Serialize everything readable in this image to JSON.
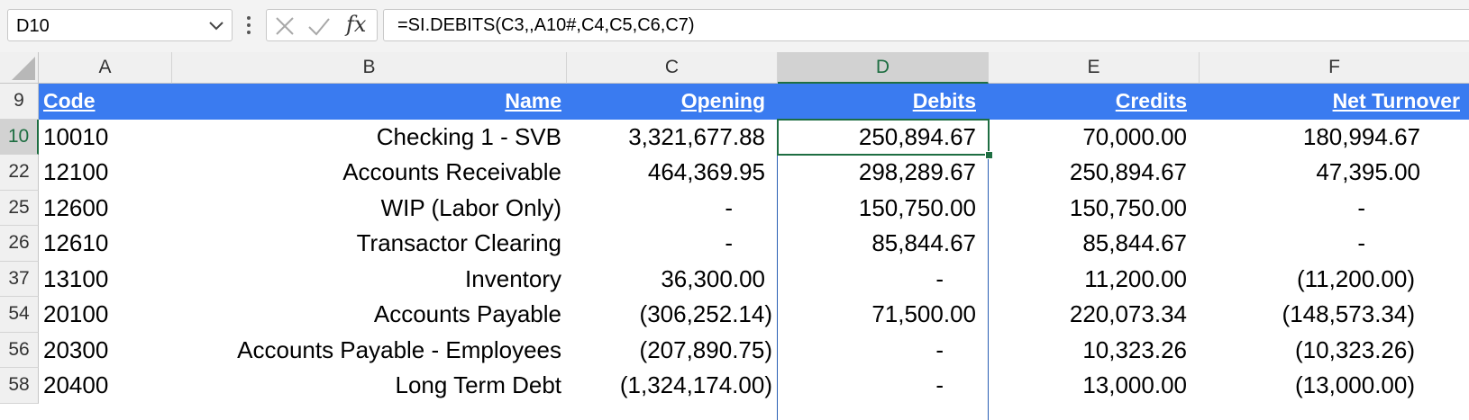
{
  "formula_bar": {
    "name_box": "D10",
    "formula": "=SI.DEBITS(C3,,A10#,C4,C5,C6,C7)",
    "fx_label": "fx"
  },
  "columns": [
    "A",
    "B",
    "C",
    "D",
    "E",
    "F"
  ],
  "selected_column": "D",
  "header_row": {
    "row_number": "9",
    "cells": [
      "Code",
      "Name",
      "Opening",
      "Debits",
      "Credits",
      "Net Turnover"
    ]
  },
  "rows": [
    {
      "row_number": "10",
      "cells": [
        "10010",
        "Checking 1 - SVB",
        "3,321,677.88",
        "250,894.67",
        "70,000.00",
        "180,994.67"
      ]
    },
    {
      "row_number": "22",
      "cells": [
        "12100",
        "Accounts Receivable",
        "464,369.95",
        "298,289.67",
        "250,894.67",
        "47,395.00"
      ]
    },
    {
      "row_number": "25",
      "cells": [
        "12600",
        "WIP (Labor Only)",
        "-",
        "150,750.00",
        "150,750.00",
        "-"
      ]
    },
    {
      "row_number": "26",
      "cells": [
        "12610",
        "Transactor Clearing",
        "-",
        "85,844.67",
        "85,844.67",
        "-"
      ]
    },
    {
      "row_number": "37",
      "cells": [
        "13100",
        "Inventory",
        "36,300.00",
        "-",
        "11,200.00",
        "(11,200.00)"
      ]
    },
    {
      "row_number": "54",
      "cells": [
        "20100",
        "Accounts Payable",
        "(306,252.14)",
        "71,500.00",
        "220,073.34",
        "(148,573.34)"
      ]
    },
    {
      "row_number": "56",
      "cells": [
        "20300",
        "Accounts Payable - Employees",
        "(207,890.75)",
        "-",
        "10,323.26",
        "(10,323.26)"
      ]
    },
    {
      "row_number": "58",
      "cells": [
        "20400",
        "Long Term Debt",
        "(1,324,174.00)",
        "-",
        "13,000.00",
        "(13,000.00)"
      ]
    }
  ],
  "colors": {
    "header_fill": "#3a7bf0",
    "selection": "#1e6e42",
    "spill_border": "#2a5fb4"
  }
}
